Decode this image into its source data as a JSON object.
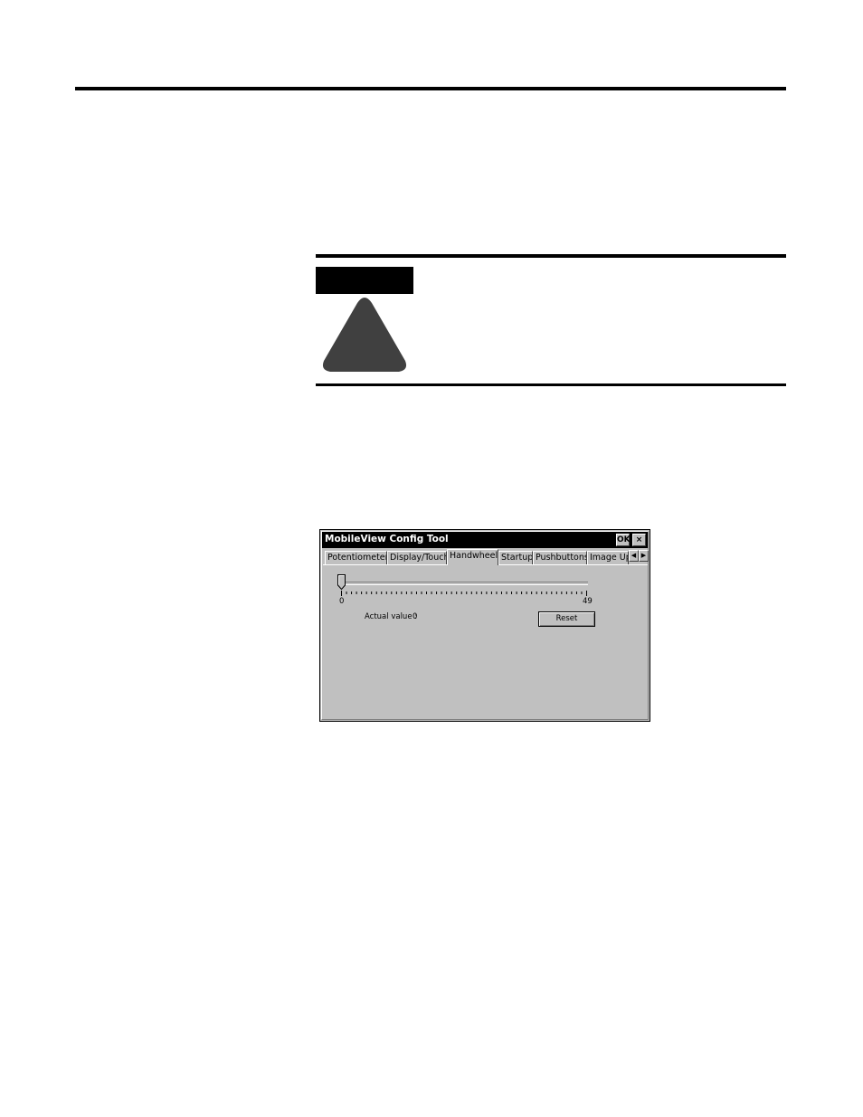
{
  "attention": {
    "label": ""
  },
  "window": {
    "title": "MobileView Config Tool",
    "ok_label": "OK",
    "close_label": "×",
    "tabs": [
      {
        "label": "Potentiometer",
        "active": false
      },
      {
        "label": "Display/Touch",
        "active": false
      },
      {
        "label": "Handwheel",
        "active": true
      },
      {
        "label": "Startup",
        "active": false
      },
      {
        "label": "Pushbuttons",
        "active": false
      },
      {
        "label": "Image Up",
        "active": false
      }
    ],
    "tab_scroll_left_icon": "arrow-left-icon",
    "tab_scroll_right_icon": "arrow-right-icon"
  },
  "handwheel": {
    "slider_min_label": "0",
    "slider_max_label": "49",
    "slider_value": 0,
    "slider_max": 49,
    "actual_value_label": "Actual value :",
    "actual_value": "0",
    "reset_label": "Reset"
  },
  "colors": {
    "window_face": "#c0c0c0",
    "titlebar": "#000000",
    "warning_triangle": "#404040"
  }
}
